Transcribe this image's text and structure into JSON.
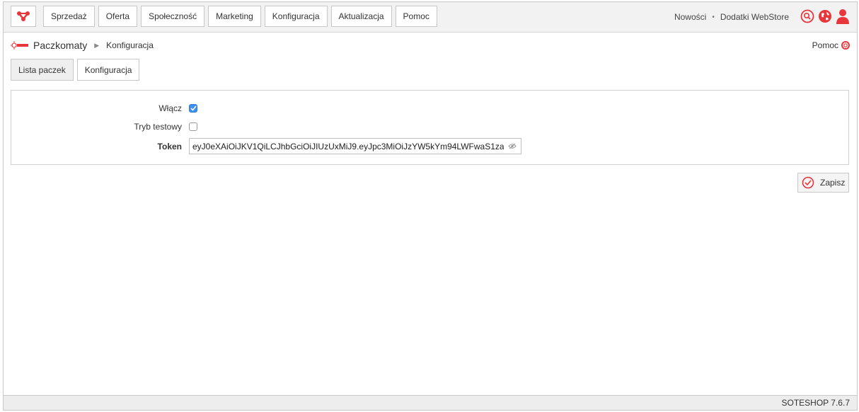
{
  "nav": {
    "items": [
      "Sprzedaż",
      "Oferta",
      "Społeczność",
      "Marketing",
      "Konfiguracja",
      "Aktualizacja",
      "Pomoc"
    ],
    "right_links": [
      "Nowości",
      "Dodatki WebStore"
    ],
    "separator": "•"
  },
  "breadcrumb": {
    "module": "Paczkomaty",
    "page": "Konfiguracja",
    "help": "Pomoc"
  },
  "tabs": [
    "Lista paczek",
    "Konfiguracja"
  ],
  "form": {
    "enable_label": "Włącz",
    "enable_checked": true,
    "test_label": "Tryb testowy",
    "test_checked": false,
    "token_label": "Token",
    "token_value": "eyJ0eXAiOiJKV1QiLCJhbGciOiJIUzUxMiJ9.eyJpc3MiOiJzYW5kYm94LWFwaS1za"
  },
  "actions": {
    "save_label": "Zapisz"
  },
  "footer": {
    "version": "SOTESHOP 7.6.7"
  },
  "colors": {
    "accent": "#e8363c",
    "checkbox": "#3b8ff0"
  }
}
